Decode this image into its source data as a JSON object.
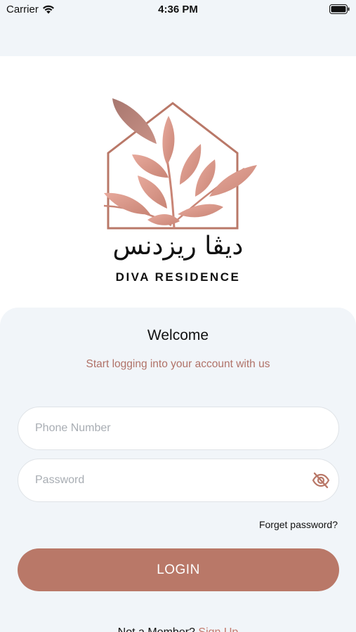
{
  "status_bar": {
    "carrier": "Carrier",
    "time": "4:36 PM"
  },
  "logo": {
    "arabic_name": "ديڤا ريزدنس",
    "english_name": "DIVA RESIDENCE",
    "colors": {
      "leaf": "#d9988c",
      "house_outline": "#b97868"
    }
  },
  "login": {
    "welcome": "Welcome",
    "subtitle": "Start logging into your account with us",
    "phone_placeholder": "Phone Number",
    "password_placeholder": "Password",
    "forgot_password": "Forget password?",
    "login_button": "LOGIN",
    "not_member": "Not a Member? ",
    "sign_up": "Sign Up"
  },
  "colors": {
    "accent": "#b97868",
    "subtitle": "#b07268",
    "card_bg": "#f1f5f9"
  }
}
